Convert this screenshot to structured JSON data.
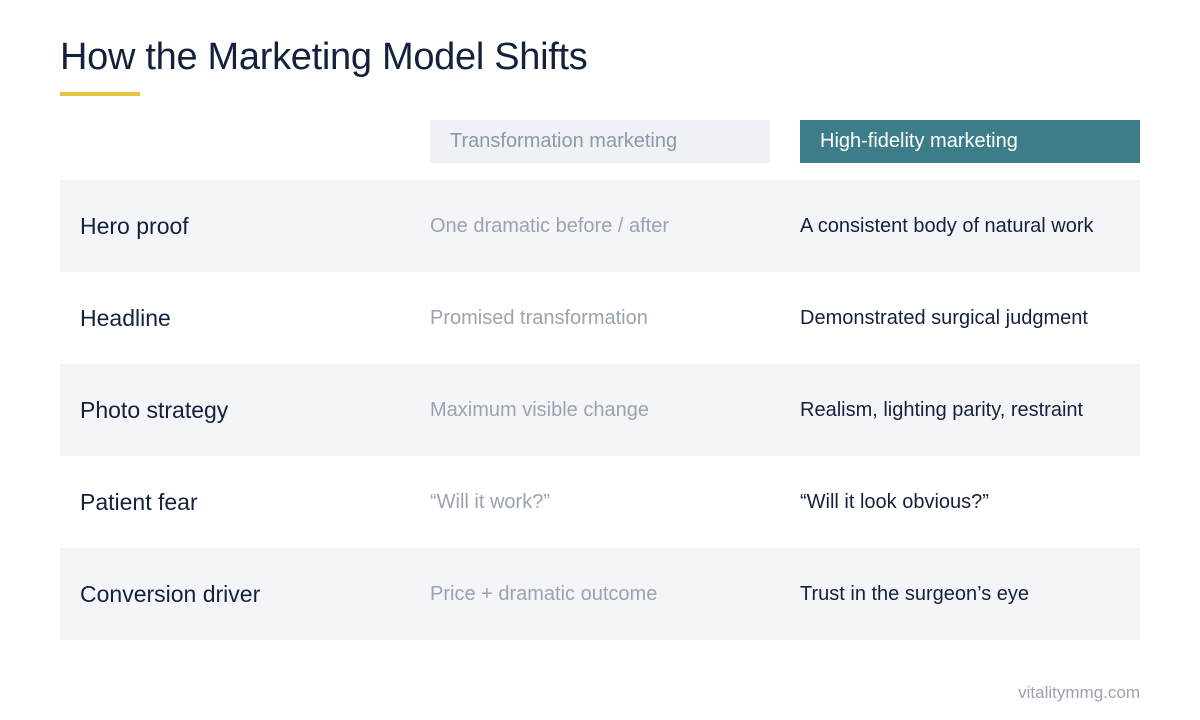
{
  "title": "How the Marketing Model Shifts",
  "colors": {
    "accent_rule": "#e6c440",
    "high_fidelity_header": "#3d7d8a",
    "transformation_header": "#eef1f6",
    "row_shade": "#f4f5f9",
    "text_dark": "#14213d",
    "text_muted": "#9aa3af"
  },
  "columns": {
    "transformation": "Transformation marketing",
    "high_fidelity": "High-fidelity marketing"
  },
  "rows": [
    {
      "label": "Hero proof",
      "transformation": "One dramatic before / after",
      "high_fidelity": "A consistent body of natural work"
    },
    {
      "label": "Headline",
      "transformation": "Promised transformation",
      "high_fidelity": "Demonstrated surgical judgment"
    },
    {
      "label": "Photo strategy",
      "transformation": "Maximum visible change",
      "high_fidelity": "Realism, lighting parity, restraint"
    },
    {
      "label": "Patient fear",
      "transformation": "“Will it work?”",
      "high_fidelity": "“Will it look obvious?”"
    },
    {
      "label": "Conversion driver",
      "transformation": "Price + dramatic outcome",
      "high_fidelity": "Trust in the surgeon’s eye"
    }
  ],
  "footer": "vitalitymmg.com"
}
